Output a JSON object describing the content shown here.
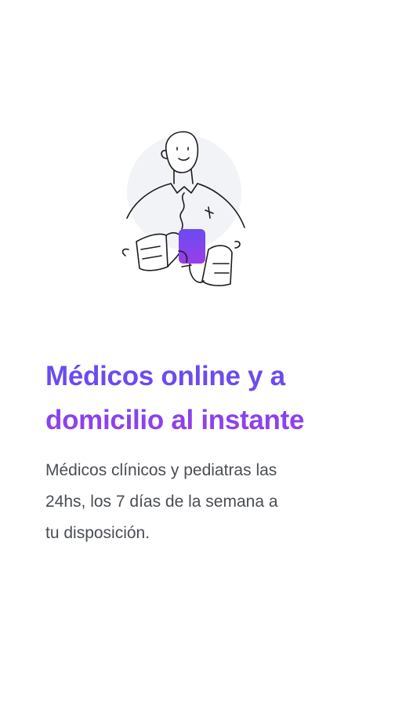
{
  "onboarding": {
    "title_lines": [
      "Médicos online y a",
      "domicilio al instante"
    ],
    "subtitle_lines": [
      "Médicos clínicos y pediatras las",
      "24hs, los 7 días de la semana a",
      "tu disposición."
    ]
  },
  "colors": {
    "title_gradient_start": "#6150f0",
    "title_gradient_end": "#a33ee6",
    "body_text": "#4a4d55",
    "illustration_circle": "#f2f3f7",
    "phone_gradient_top": "#6a4cf2",
    "phone_gradient_bottom": "#9a3de8"
  },
  "illustration": {
    "icon": "person-holding-phone-icon"
  }
}
